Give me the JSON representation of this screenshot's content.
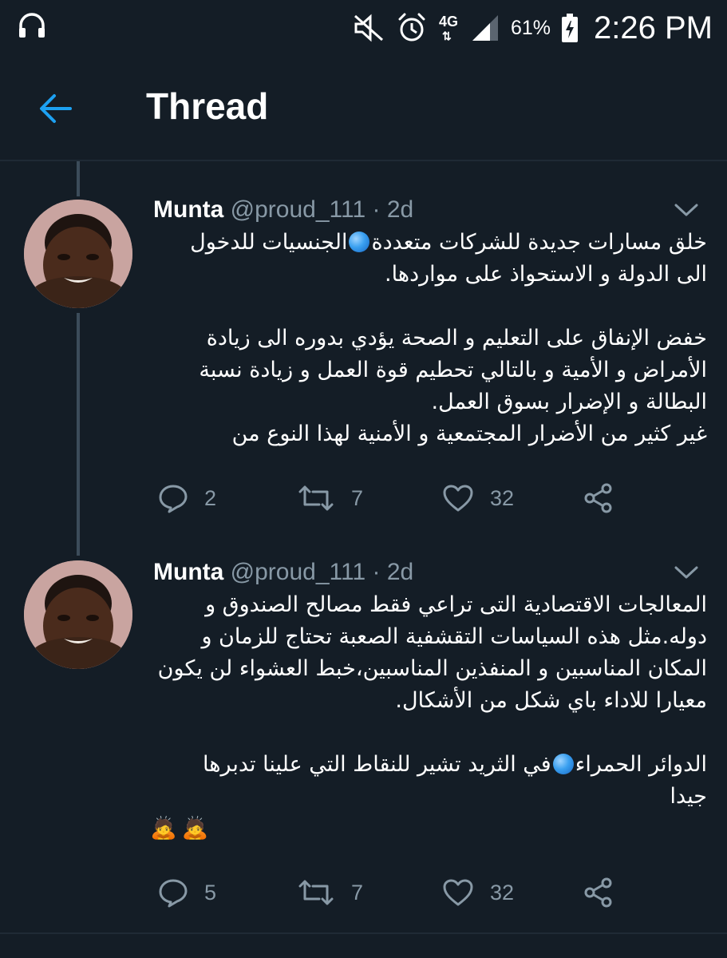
{
  "status_bar": {
    "network_type": "4G",
    "network_arrows": "⇅",
    "battery_percent": "61%",
    "time": "2:26 PM"
  },
  "app_bar": {
    "title": "Thread",
    "accent_color": "#1da1f2"
  },
  "tweets": [
    {
      "name": "Munta",
      "handle": "@proud_111",
      "separator": "·",
      "time": "2d",
      "lines": [
        [
          "خلق مسارات جديدة للشركات متعددة",
          {
            "icon": "blue-circle-emoji"
          },
          "الجنسيات للدخول"
        ],
        [
          "الى الدولة و الاستحواذ على مواردها."
        ],
        [],
        [
          "خفض الإنفاق على التعليم و الصحة يؤدي بدوره الى زيادة"
        ],
        [
          "الأمراض و الأمية و بالتالي تحطيم قوة العمل و زيادة نسبة"
        ],
        [
          "البطالة و الإضرار بسوق العمل."
        ],
        [
          "غير كثير من الأضرار المجتمعية و الأمنية لهذا النوع من"
        ]
      ],
      "replies": "2",
      "retweets": "7",
      "likes": "32"
    },
    {
      "name": "Munta",
      "handle": "@proud_111",
      "separator": "·",
      "time": "2d",
      "lines": [
        [
          "المعالجات الاقتصادية التى تراعي فقط مصالح الصندوق و"
        ],
        [
          "دوله.مثل هذه السياسات التقشفية الصعبة تحتاج للزمان و"
        ],
        [
          "المكان المناسبين و المنفذين المناسبين،خبط العشواء لن يكون"
        ],
        [
          "معيارا للاداء باي شكل من الأشكال."
        ],
        [],
        [
          "الدوائر الحمراء",
          {
            "icon": "blue-circle-emoji"
          },
          "في الثريد تشير للنقاط التي علينا تدبرها"
        ],
        [
          "جيدا"
        ]
      ],
      "emoji": [
        "🙇",
        "🙇"
      ],
      "replies": "5",
      "retweets": "7",
      "likes": "32"
    }
  ]
}
